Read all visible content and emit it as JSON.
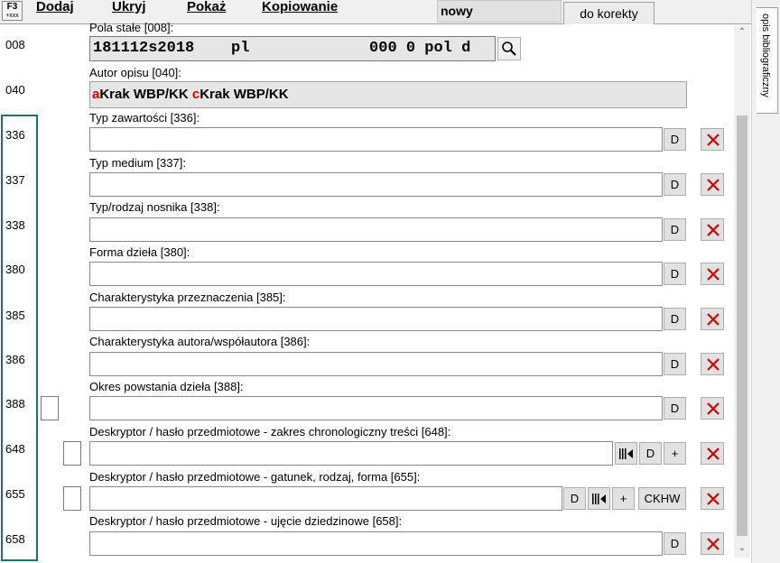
{
  "toolbar": {
    "f3_main": "F3",
    "f3_sub": "+xxx",
    "menu": [
      "Dodaj",
      "Ukryj",
      "Pokaż",
      "Kopiowanie"
    ],
    "status": "nowy",
    "tab": "do korekty"
  },
  "side_tab": "opis bibliograficzny",
  "fields": {
    "f008": {
      "tag": "008",
      "label": "Pola stałe [008]:",
      "value": "181112s2018    pl             000 0 pol d"
    },
    "f040": {
      "tag": "040",
      "label": "Autor opisu [040]:",
      "sub1_code": "a",
      "sub1_value": "Krak WBP/KK ",
      "sub2_code": "c",
      "sub2_value": "Krak WBP/KK"
    },
    "f336": {
      "tag": "336",
      "label": "Typ zawartości [336]:",
      "value": ""
    },
    "f337": {
      "tag": "337",
      "label": "Typ medium [337]:",
      "value": ""
    },
    "f338": {
      "tag": "338",
      "label": "Typ/rodzaj nosnika [338]:",
      "value": ""
    },
    "f380": {
      "tag": "380",
      "label": "Forma dzieła [380]:",
      "value": ""
    },
    "f385": {
      "tag": "385",
      "label": "Charakterystyka przeznaczenia [385]:",
      "value": ""
    },
    "f386": {
      "tag": "386",
      "label": "Charakterystyka autora/współautora [386]:",
      "value": ""
    },
    "f388": {
      "tag": "388",
      "label": "Okres powstania dzieła [388]:",
      "value": ""
    },
    "f648": {
      "tag": "648",
      "label": "Deskryptor / hasło przedmiotowe - zakres chronologiczny treści [648]:",
      "value": ""
    },
    "f655": {
      "tag": "655",
      "label": "Deskryptor / hasło przedmiotowe - gatunek, rodzaj, forma [655]:",
      "value": ""
    },
    "f658": {
      "tag": "658",
      "label": "Deskryptor / hasło przedmiotowe - ujęcie dziedzinowe [658]:",
      "value": ""
    }
  },
  "buttons": {
    "d": "D",
    "plus": "+",
    "ckhw": "CKHW"
  },
  "colors": {
    "frame": "#1e6e72",
    "subfield_code": "#d40000",
    "delete_x": "#d40000"
  },
  "icons": [
    "search-icon",
    "delete-x-icon",
    "reverse-arrow-icon",
    "scroll-up-arrow",
    "scroll-down-arrow"
  ]
}
